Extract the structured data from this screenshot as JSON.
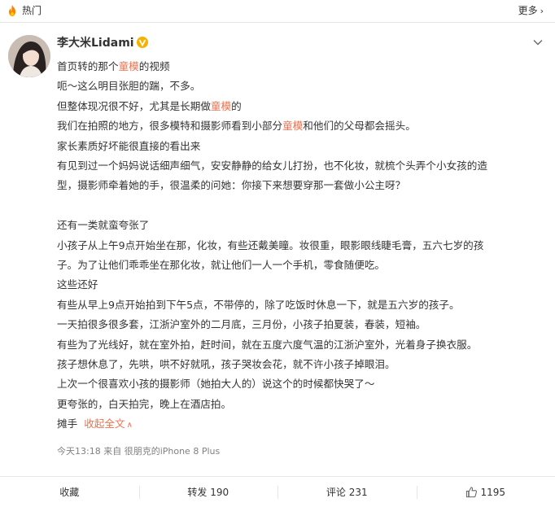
{
  "topbar": {
    "title": "热门",
    "more_label": "更多"
  },
  "post": {
    "username": "李大米Lidami",
    "lines": [
      [
        {
          "t": "首页转的那个"
        },
        {
          "t": "童模",
          "hl": true
        },
        {
          "t": "的视频"
        }
      ],
      [
        {
          "t": "呃～这么明目张胆的踹，不多。"
        }
      ],
      [
        {
          "t": "但整体现况很不好，尤其是长期做"
        },
        {
          "t": "童模",
          "hl": true
        },
        {
          "t": "的"
        }
      ],
      [
        {
          "t": "我们在拍照的地方，很多模特和摄影师看到小部分"
        },
        {
          "t": "童模",
          "hl": true
        },
        {
          "t": "和他们的父母都会摇头。"
        }
      ],
      [
        {
          "t": "家长素质好坏能很直接的看出来"
        }
      ],
      [
        {
          "t": "有见到过一个妈妈说话细声细气，安安静静的给女儿打扮，也不化妆，就梳个头弄个小女孩的造"
        }
      ],
      [
        {
          "t": "型，摄影师牵着她的手，很温柔的问她：你接下来想要穿那一套做小公主呀？"
        }
      ],
      [],
      [
        {
          "t": "还有一类就蛮夸张了"
        }
      ],
      [
        {
          "t": "小孩子从上午9点开始坐在那，化妆，有些还戴美瞳。妆很重，眼影眼线睫毛膏，五六七岁的孩"
        }
      ],
      [
        {
          "t": "子。为了让他们乖乖坐在那化妆，就让他们一人一个手机，零食随便吃。"
        }
      ],
      [
        {
          "t": "这些还好"
        }
      ],
      [
        {
          "t": "有些从早上9点开始拍到下午5点，不带停的，除了吃饭时休息一下，就是五六岁的孩子。"
        }
      ],
      [
        {
          "t": "一天拍很多很多套，江浙沪室外的二月底，三月份，小孩子拍夏装，春装，短袖。"
        }
      ],
      [
        {
          "t": "有些为了光线好，就在室外拍，赶时间，就在五度六度气温的江浙沪室外，光着身子换衣服。"
        }
      ],
      [
        {
          "t": "孩子想休息了，先哄，哄不好就吼，孩子哭妆会花，就不许小孩子掉眼泪。"
        }
      ],
      [
        {
          "t": "上次一个很喜欢小孩的摄影师（她拍大人的）说这个的时候都快哭了～"
        }
      ],
      [
        {
          "t": "更夸张的，白天拍完，晚上在酒店拍。"
        }
      ]
    ],
    "last_line_text": "摊手",
    "collapse_label": "收起全文",
    "meta": "今天13:18 来自 很朋克的iPhone 8 Plus"
  },
  "actions": {
    "favorite": "收藏",
    "repost": "转发 190",
    "comment": "评论 231",
    "like_count": "1195"
  },
  "colors": {
    "accent": "#eb7350",
    "text": "#333333",
    "meta": "#808080",
    "vip_badge": "#f8b100"
  }
}
